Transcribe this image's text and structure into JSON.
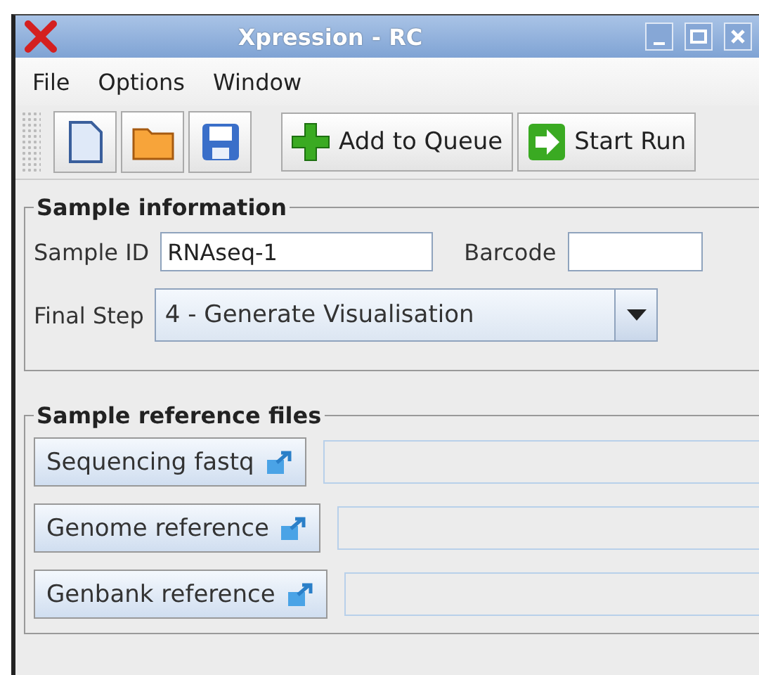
{
  "window": {
    "title": "Xpression - RC"
  },
  "menu": [
    "File",
    "Options",
    "Window"
  ],
  "toolbar": {
    "icon_buttons": [
      {
        "kind": "new"
      },
      {
        "kind": "open"
      },
      {
        "kind": "save"
      }
    ],
    "text_buttons": [
      {
        "kind": "add",
        "label": "Add to Queue"
      },
      {
        "kind": "run",
        "label": "Start Run"
      }
    ]
  },
  "sample_information": {
    "title": "Sample information",
    "sample_id": {
      "label": "Sample ID",
      "value": "RNAseq-1"
    },
    "barcode": {
      "label": "Barcode"
    },
    "final_step": {
      "label": "Final Step",
      "value": "4 - Generate Visualisation"
    }
  },
  "sample_reference_files": {
    "title": "Sample reference files",
    "files": [
      {
        "label": "Sequencing fastq",
        "disabled": true
      },
      {
        "label": "Genome reference",
        "disabled": true
      },
      {
        "label": "Genbank reference",
        "disabled": true
      }
    ]
  }
}
